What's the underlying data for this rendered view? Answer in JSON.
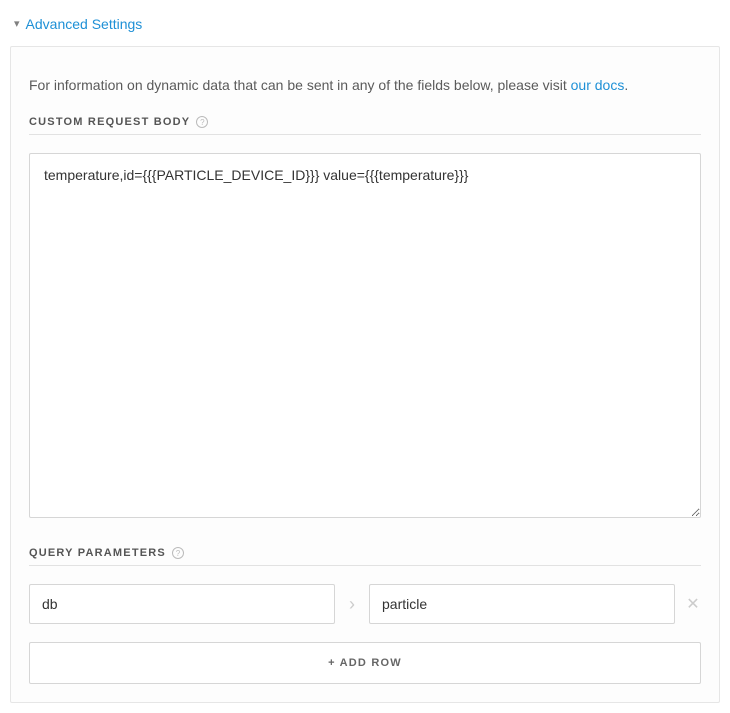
{
  "header": {
    "title": "Advanced Settings"
  },
  "info": {
    "text_before": "For information on dynamic data that can be sent in any of the fields below, please visit ",
    "link_text": "our docs",
    "text_after": "."
  },
  "sections": {
    "custom_body": {
      "label": "CUSTOM REQUEST BODY",
      "value": "temperature,id={{{PARTICLE_DEVICE_ID}}} value={{{temperature}}}"
    },
    "query_params": {
      "label": "QUERY PARAMETERS",
      "rows": [
        {
          "key": "db",
          "value": "particle"
        }
      ],
      "add_row_label": "+ ADD ROW"
    }
  }
}
